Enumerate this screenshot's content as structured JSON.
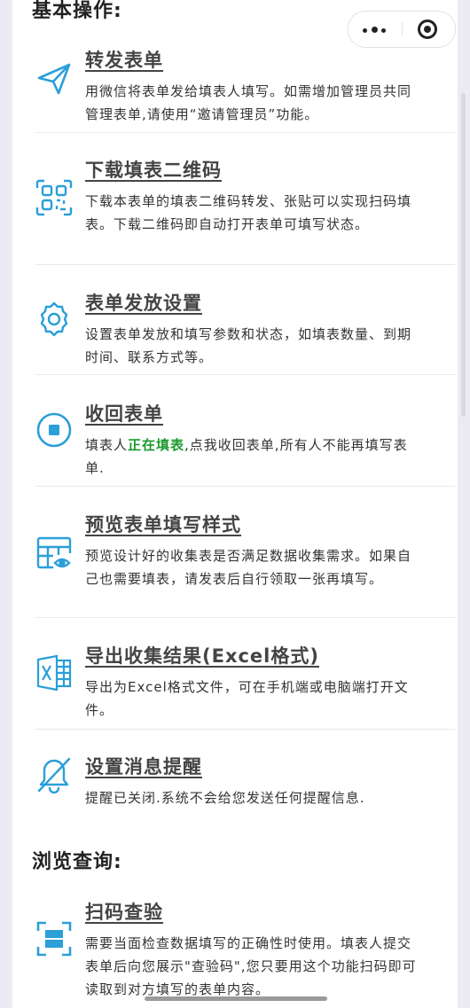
{
  "sections": {
    "basic": "基本操作:",
    "browse": "浏览查询:"
  },
  "items": [
    {
      "title": "转发表单",
      "desc": "用微信将表单发给填表人填写。如需增加管理员共同管理表单,请使用“邀请管理员”功能。",
      "icon": "send-icon"
    },
    {
      "title": "下载填表二维码",
      "desc": "下载本表单的填表二维码转发、张贴可以实现扫码填表。下载二维码即自动打开表单可填写状态。",
      "icon": "qrcode-icon"
    },
    {
      "title": "表单发放设置",
      "desc": "设置表单发放和填写参数和状态，如填表数量、到期时间、联系方式等。",
      "icon": "gear-icon"
    },
    {
      "title": "收回表单",
      "desc_pre": "填表人",
      "desc_status": "正在填表",
      "desc_post": ",点我收回表单,所有人不能再填写表单.",
      "icon": "stop-icon"
    },
    {
      "title": "预览表单填写样式",
      "desc": "预览设计好的收集表是否满足数据收集需求。如果自己也需要填表，请发表后自行领取一张再填写。",
      "icon": "preview-table-icon"
    },
    {
      "title": "导出收集结果(Excel格式)",
      "desc": "导出为Excel格式文件，可在手机端或电脑端打开文件。",
      "icon": "excel-icon"
    },
    {
      "title": "设置消息提醒",
      "desc": "提醒已关闭.系统不会给您发送任何提醒信息.",
      "icon": "bell-off-icon"
    },
    {
      "title": "扫码查验",
      "desc": "需要当面检查数据填写的正确性时使用。填表人提交表单后向您展示\"查验码\",您只要用这个功能扫码即可读取到对方填写的表单内容。",
      "icon": "scan-icon"
    }
  ],
  "colors": {
    "icon": "#2a9fd8",
    "status_green": "#1a9a2c"
  }
}
